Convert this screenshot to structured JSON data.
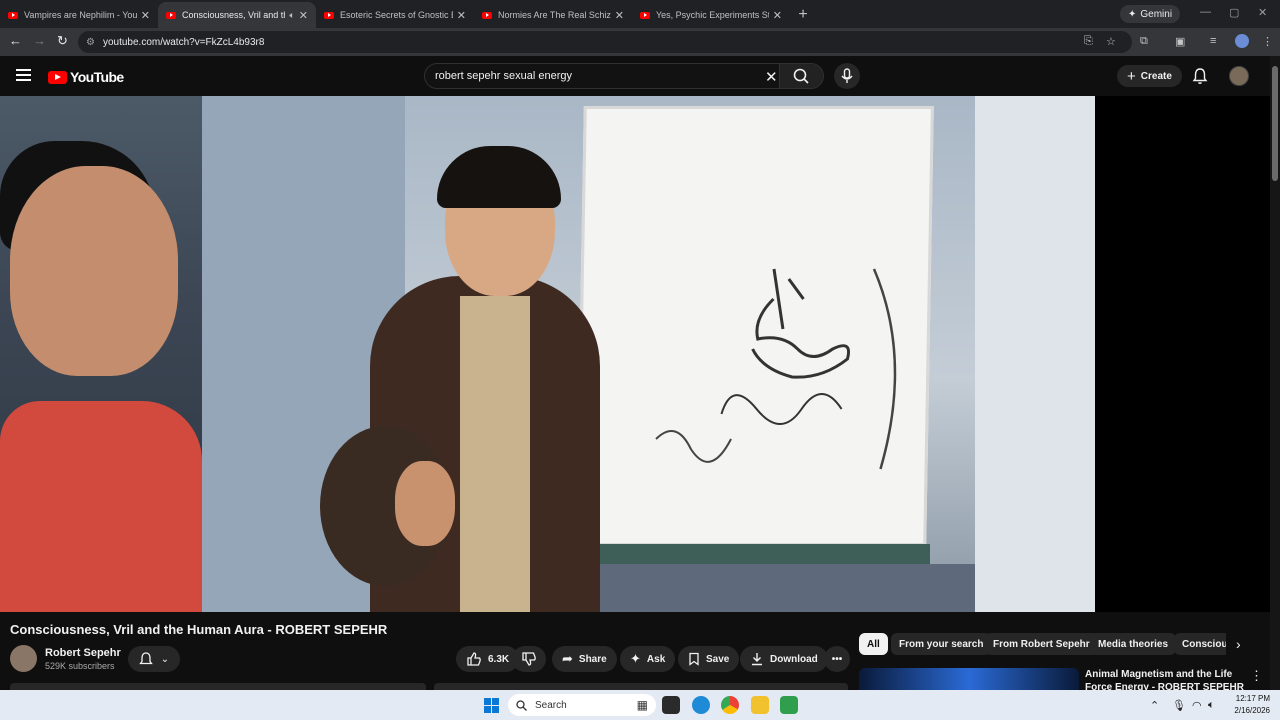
{
  "browser": {
    "tabs": [
      {
        "title": "Vampires are Nephilim - YouTube",
        "active": false
      },
      {
        "title": "Consciousness, Vril and the Human Aura",
        "active": true
      },
      {
        "title": "Esoteric Secrets of Gnostic Baptism",
        "active": false
      },
      {
        "title": "Normies Are The Real Schizos",
        "active": false
      },
      {
        "title": "Yes, Psychic Experiments Still Happen",
        "active": false
      }
    ],
    "gemini_label": "Gemini",
    "url": "youtube.com/watch?v=FkZcL4b93r8"
  },
  "youtube": {
    "logo_text": "YouTube",
    "search_query": "robert sepehr sexual energy",
    "create_label": "Create"
  },
  "video": {
    "title": "Consciousness, Vril and the Human Aura - ROBERT SEPEHR",
    "channel": "Robert Sepehr",
    "subscribers": "529K subscribers",
    "likes": "6.3K",
    "share_label": "Share",
    "ask_label": "Ask",
    "save_label": "Save",
    "download_label": "Download"
  },
  "sidebar": {
    "chips": [
      "All",
      "From your search",
      "From Robert Sepehr",
      "Media theories",
      "Consciou"
    ],
    "recommended_title": "Animal Magnetism and the Life Force Energy - ROBERT SEPEHR"
  },
  "taskbar": {
    "search_label": "Search",
    "time": "12:17 PM",
    "date": "2/16/2026"
  },
  "colors": {
    "youtube_red": "#ff0000",
    "background": "#0f0f0f",
    "chip_bg": "#272727"
  }
}
